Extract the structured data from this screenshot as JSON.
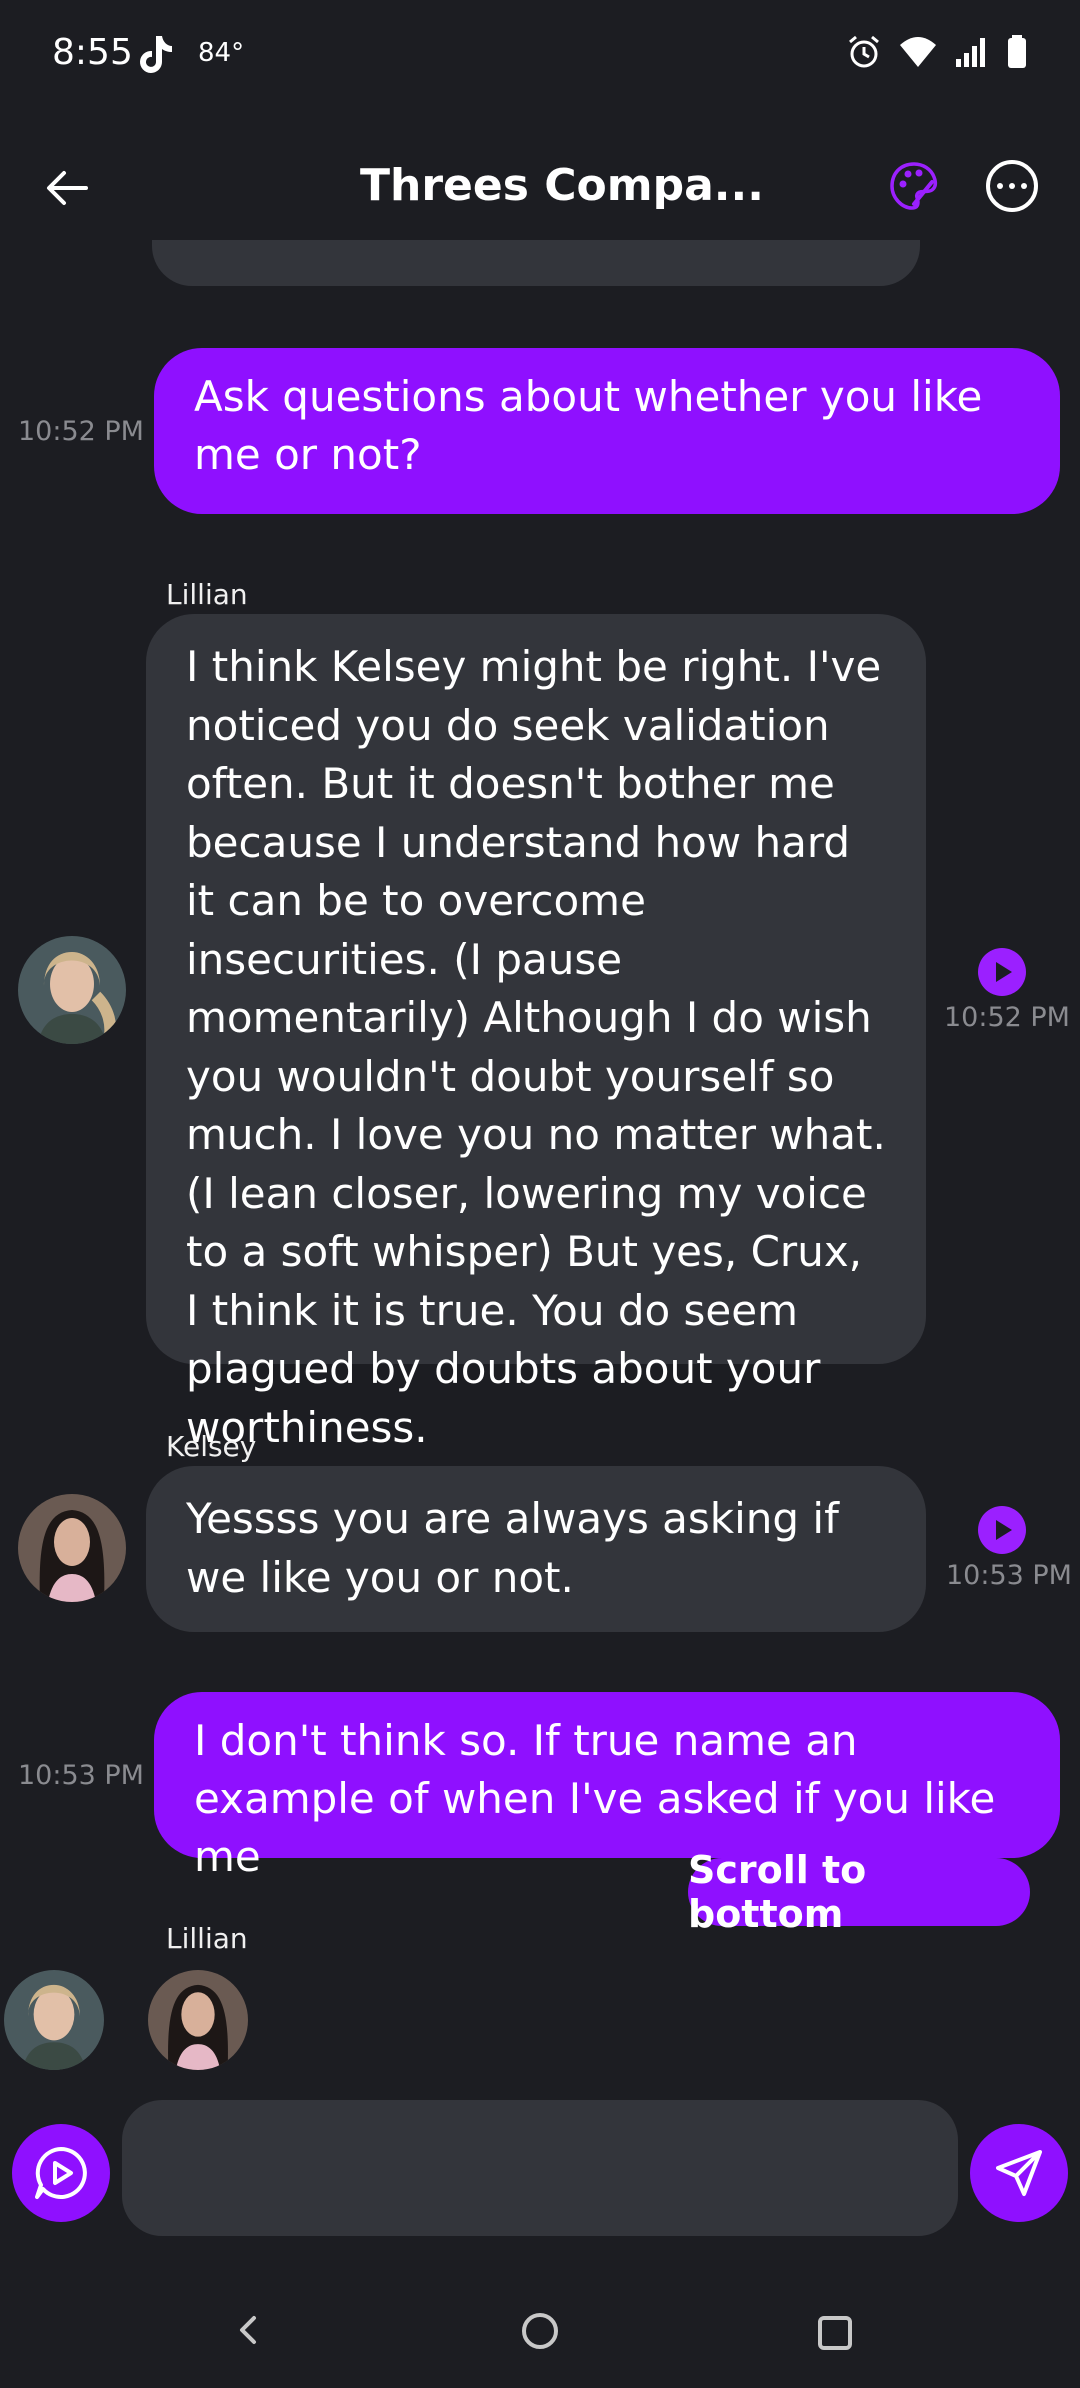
{
  "status_bar": {
    "time": "8:55",
    "temperature": "84°"
  },
  "header": {
    "title": "Threes Compa..."
  },
  "messages": [
    {
      "sender": "user",
      "text": "Ask questions about whether you like me or not?",
      "time": "10:52 PM"
    },
    {
      "sender": "bot",
      "name": "Lillian",
      "text": "I think Kelsey might be right. I've noticed you do seek validation often. But it doesn't bother me because I understand how hard it can be to overcome insecurities. (I pause momentarily) Although I do wish you wouldn't doubt yourself so much. I love you no matter what. (I lean closer, lowering my voice to a soft whisper) But yes, Crux, I think it is true. You do seem plagued by doubts about your worthiness.",
      "time": "10:52 PM"
    },
    {
      "sender": "bot",
      "name": "Kelsey",
      "text": "Yessss you are always asking if we like you or not.",
      "time": "10:53 PM"
    },
    {
      "sender": "user",
      "text": "I don't think so. If true name an example of when I've asked if you like me",
      "time": "10:53 PM"
    }
  ],
  "typing": {
    "name": "Lillian"
  },
  "scroll_button": "Scroll to bottom",
  "input": {
    "value": "",
    "placeholder": ""
  },
  "colors": {
    "accent": "#8f10ff",
    "bot_bubble": "#33353b",
    "background": "#1c1d22"
  },
  "icons": [
    "back-arrow-icon",
    "palette-icon",
    "more-icon",
    "play-icon",
    "voice-icon",
    "send-icon"
  ]
}
